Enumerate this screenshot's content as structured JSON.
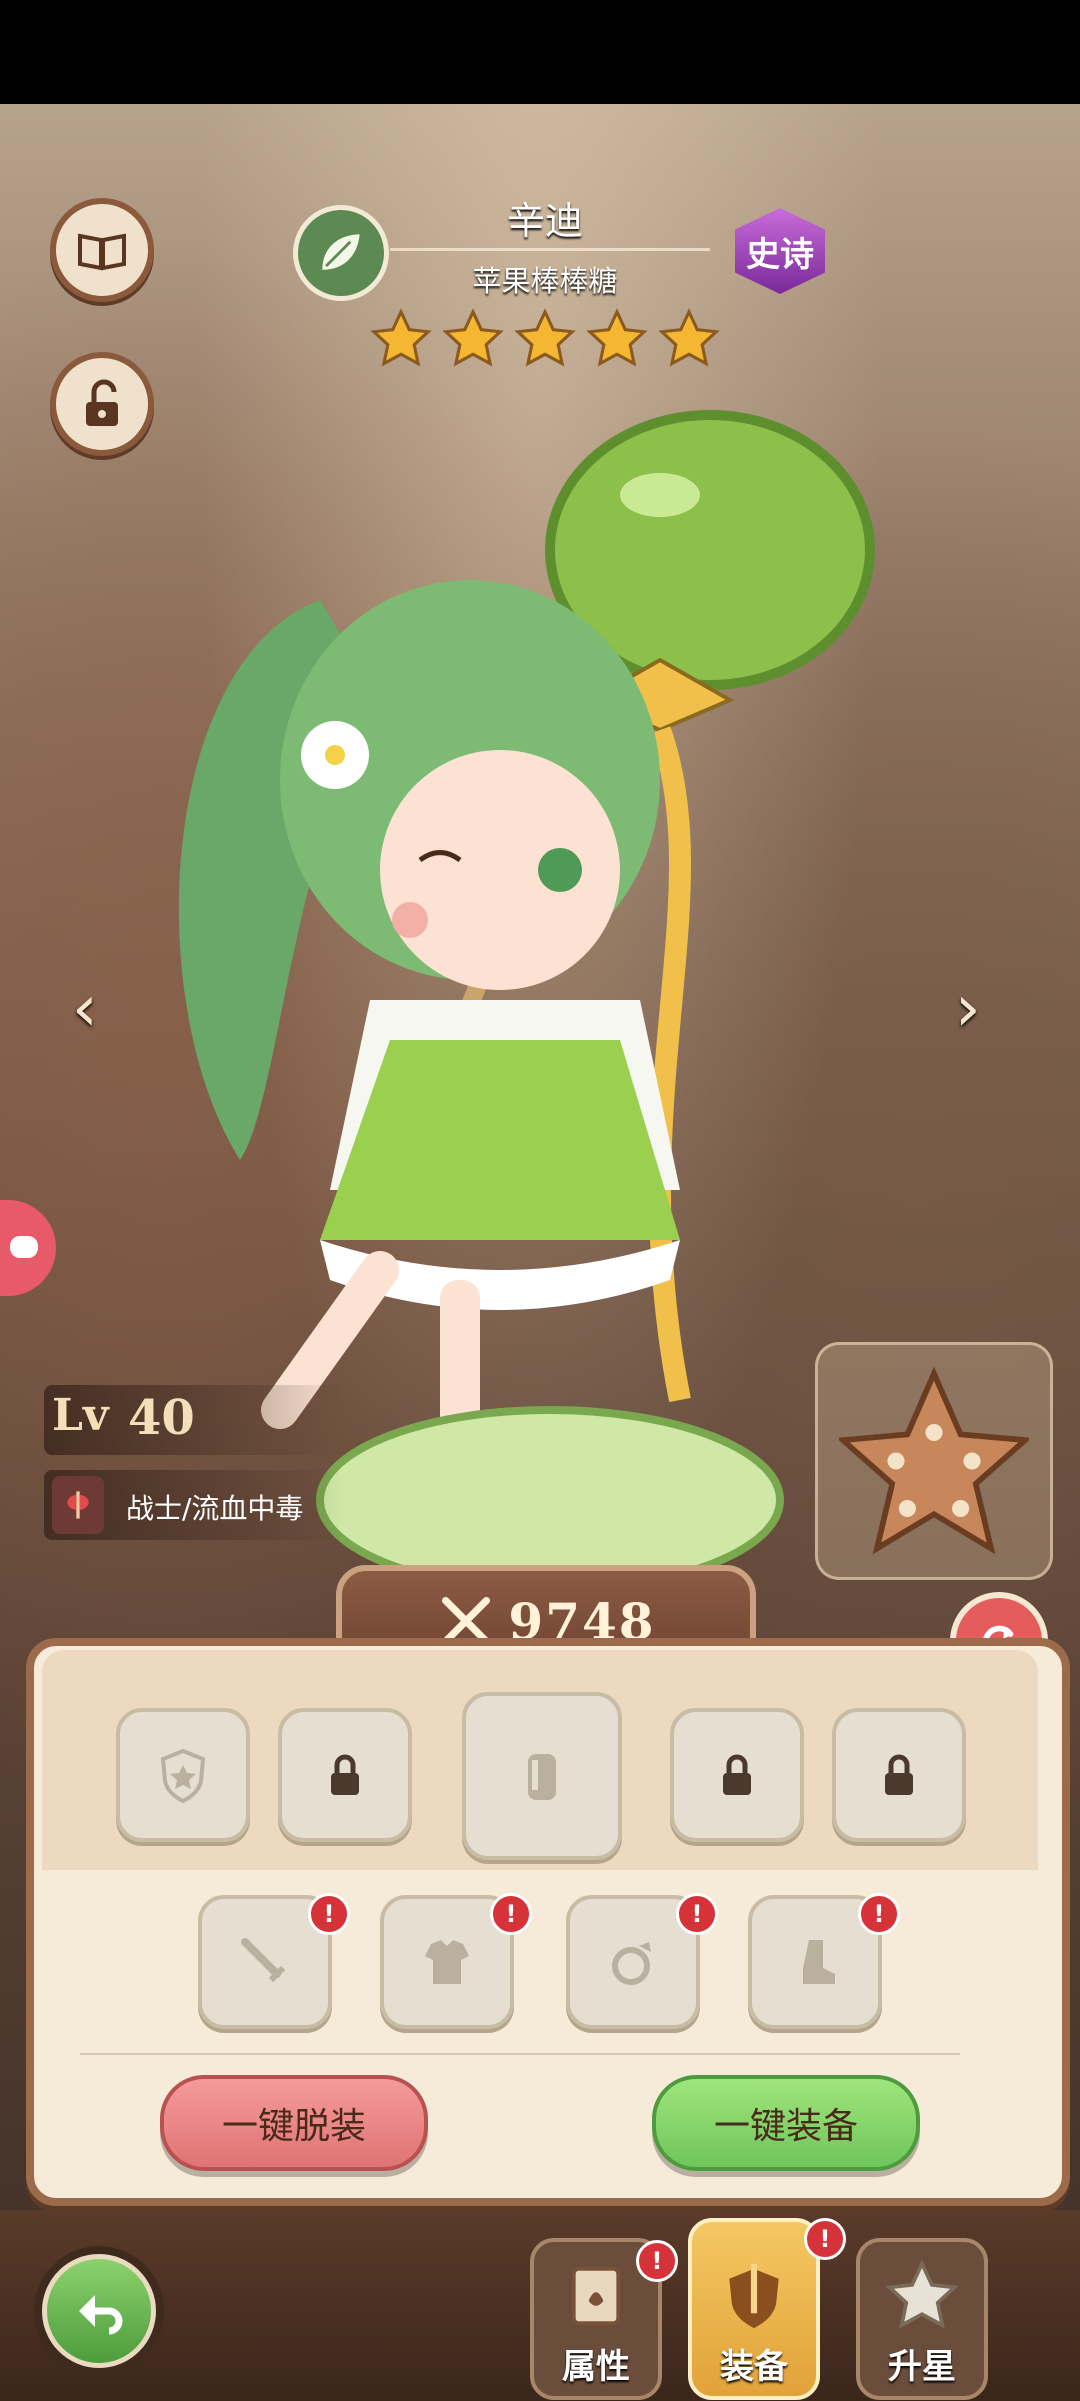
{
  "character": {
    "name": "辛迪",
    "subtitle": "苹果棒棒糖",
    "rarity": "史诗",
    "stars": 5,
    "level_label": "Lv",
    "level": "40",
    "tags": "战士/流血中毒",
    "power": "9748"
  },
  "icons": {
    "book": "book-icon",
    "lock": "unlock-icon",
    "class": "leaf-icon",
    "refresh": "refresh-icon",
    "back": "back-arrow-icon"
  },
  "equipment": {
    "unequip_all": "一键脱装",
    "equip_all": "一键装备",
    "top_slots": [
      "badge",
      "locked",
      "canister",
      "locked",
      "locked"
    ],
    "gear_slots": [
      "sword",
      "armor",
      "ring",
      "boots"
    ]
  },
  "tabs": [
    {
      "label": "属性",
      "alert": "!"
    },
    {
      "label": "装备",
      "alert": "!"
    },
    {
      "label": "升星",
      "alert": ""
    }
  ],
  "colors": {
    "rarity": "#9b3fb5",
    "accent_green": "#6fc65b",
    "accent_red": "#e07474"
  }
}
